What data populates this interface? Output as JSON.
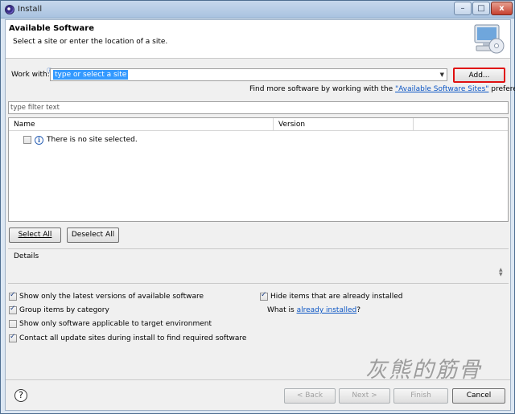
{
  "window": {
    "title": "Install",
    "buttons": {
      "minimize": "–",
      "maximize": "□",
      "close": "x"
    }
  },
  "header": {
    "title": "Available Software",
    "description": "Select a site or enter the location of a site."
  },
  "work_with": {
    "label": "Work with:",
    "value": "type or select a site",
    "add_button": "Add...",
    "find_more_prefix": "Find more software by working with the ",
    "find_more_link": "\"Available Software Sites\"",
    "find_more_suffix": " preferences."
  },
  "filter": {
    "placeholder": "type filter text"
  },
  "tree": {
    "columns": [
      "Name",
      "Version"
    ],
    "rows": [
      {
        "checked": false,
        "text": "There is no site selected."
      }
    ]
  },
  "buttons": {
    "select_all": "Select All",
    "deselect_all": "Deselect All"
  },
  "details": {
    "label": "Details"
  },
  "options": {
    "latest_versions": {
      "label": "Show only the latest versions of available software",
      "checked": true
    },
    "group_by_category": {
      "label": "Group items by category",
      "checked": true
    },
    "target_env": {
      "label": "Show only software applicable to target environment",
      "checked": false
    },
    "contact_sites": {
      "label": "Contact all update sites during install to find required software",
      "checked": true
    },
    "hide_installed": {
      "label": "Hide items that are already installed",
      "checked": true
    },
    "what_is_prefix": "What is ",
    "what_is_link": "already installed",
    "what_is_suffix": "?"
  },
  "watermark": "灰熊的筋骨",
  "footer": {
    "help": "?",
    "back": "< Back",
    "next": "Next >",
    "finish": "Finish",
    "cancel": "Cancel"
  }
}
